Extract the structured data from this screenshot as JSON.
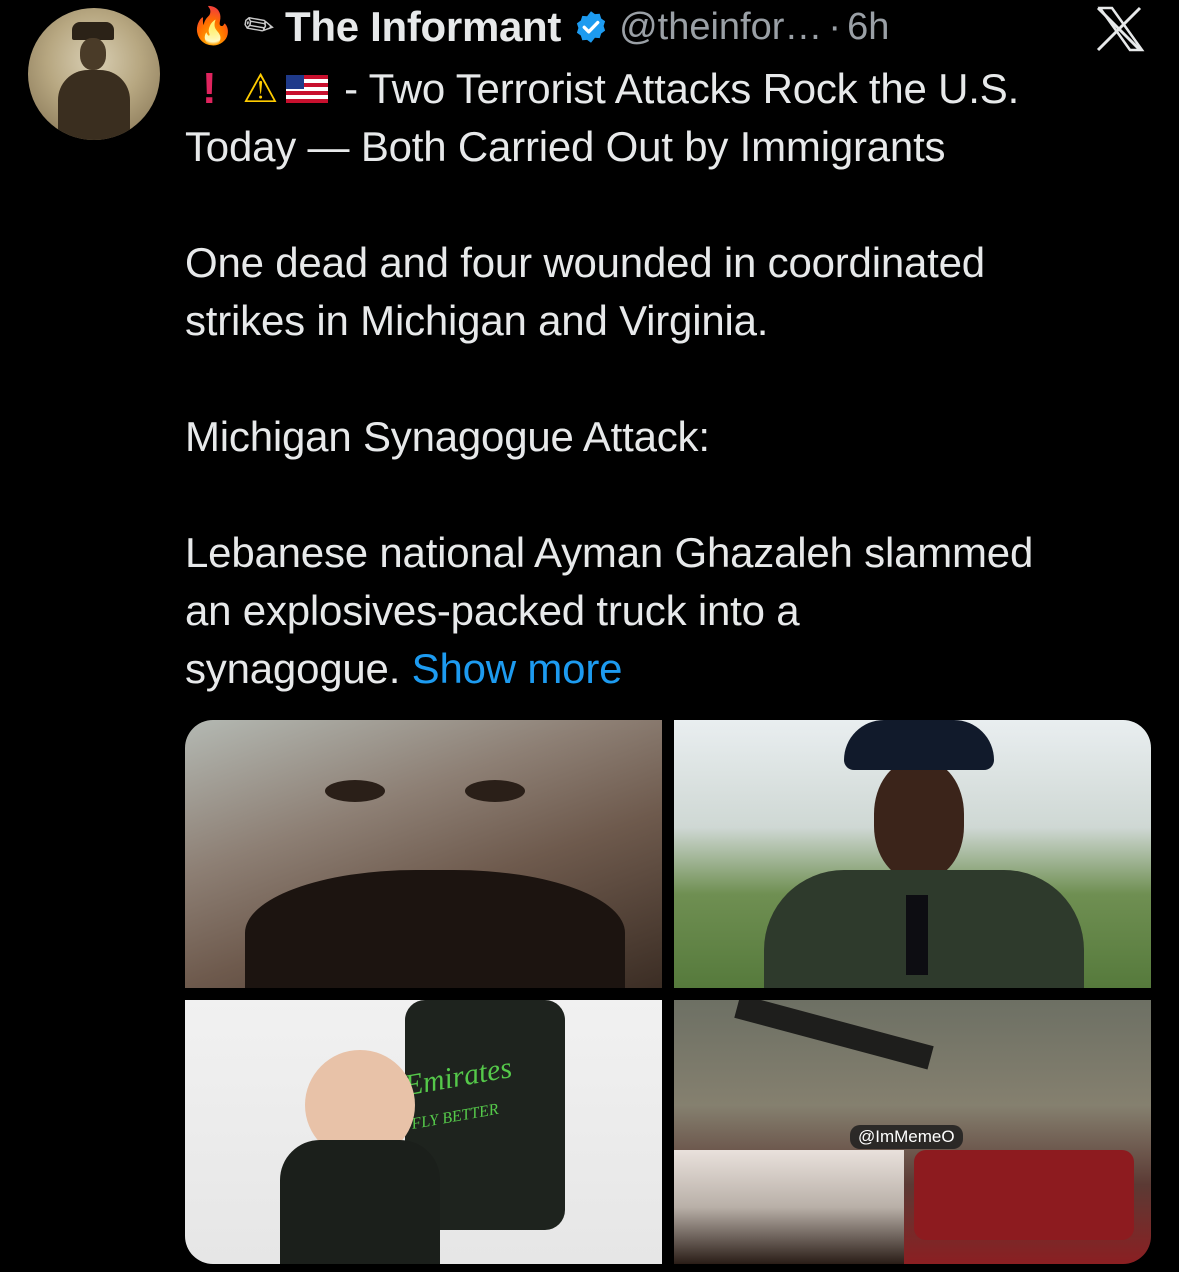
{
  "author": {
    "name": "The Informant",
    "handle": "@theinfor…",
    "dot": "·",
    "time": "6h"
  },
  "icons": {
    "fire": "fire-icon",
    "scroll": "scroll-icon",
    "verified": "verified-badge-icon",
    "platform": "x-logo-icon",
    "exclamation": "red-exclamation-icon",
    "warning": "warning-icon",
    "flag": "us-flag-icon"
  },
  "colors": {
    "background": "#000000",
    "text": "#e7e9ea",
    "muted": "#9aa0a6",
    "link": "#1d9bf0",
    "verified": "#1d9bf0"
  },
  "tweet": {
    "headline_rest": " - Two Terrorist Attacks Rock the U.S.",
    "headline_line2": "Today — Both Carried Out by Immigrants",
    "para1": "One dead and four wounded in coordinated\nstrikes in Michigan and Virginia.",
    "para2": "Michigan Synagogue Attack:",
    "para3": "Lebanese national Ayman Ghazaleh slammed\nan explosives-packed truck into a\nsynagogue. ",
    "show_more": "Show more"
  },
  "media": {
    "sponsor_text": "Emirates",
    "sponsor_sub": "FLY BETTER",
    "watermark": "@ImMemeO"
  }
}
